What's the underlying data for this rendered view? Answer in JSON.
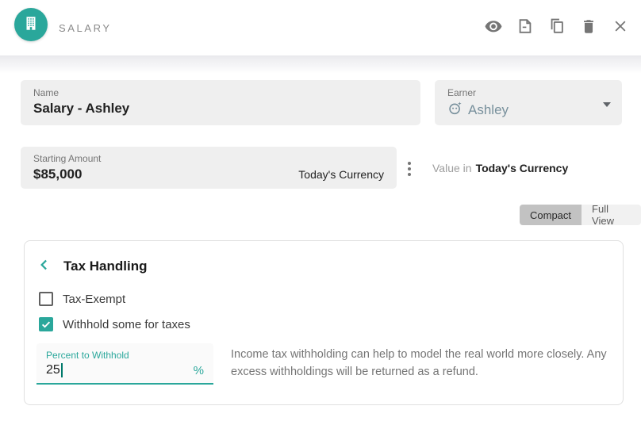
{
  "header": {
    "title": "SALARY",
    "item_icon": "building-icon",
    "actions": [
      {
        "name": "visibility",
        "icon": "eye-icon"
      },
      {
        "name": "note",
        "icon": "note-icon"
      },
      {
        "name": "duplicate",
        "icon": "copy-icon"
      },
      {
        "name": "delete",
        "icon": "trash-icon"
      },
      {
        "name": "close",
        "icon": "close-icon"
      }
    ]
  },
  "fields": {
    "name": {
      "label": "Name",
      "value": "Salary - Ashley"
    },
    "earner": {
      "label": "Earner",
      "value": "Ashley",
      "icon": "face-icon"
    },
    "starting_amount": {
      "label": "Starting Amount",
      "value": "$85,000",
      "suffix": "Today's Currency"
    },
    "value_in": {
      "prefix": "Value in",
      "value": "Today's Currency"
    }
  },
  "view_toggle": {
    "options": [
      {
        "label": "Compact",
        "selected": true
      },
      {
        "label": "Full View",
        "selected": false
      }
    ]
  },
  "tax_card": {
    "title": "Tax Handling",
    "checkboxes": [
      {
        "label": "Tax-Exempt",
        "checked": false
      },
      {
        "label": "Withhold some for taxes",
        "checked": true
      }
    ],
    "percent_field": {
      "label": "Percent to Withhold",
      "value": "25",
      "suffix": "%"
    },
    "description": "Income tax withholding can help to model the real world more closely. Any excess withholdings will be returned as a refund."
  },
  "colors": {
    "accent_teal": "#2aa79b",
    "icon_gray": "#757575",
    "field_bg": "#efefef",
    "earner_text": "#78909c",
    "selected_segment_bg": "#c2c2c2",
    "unselected_segment_bg": "#f1f1f1",
    "card_border": "#e0e0e0"
  }
}
